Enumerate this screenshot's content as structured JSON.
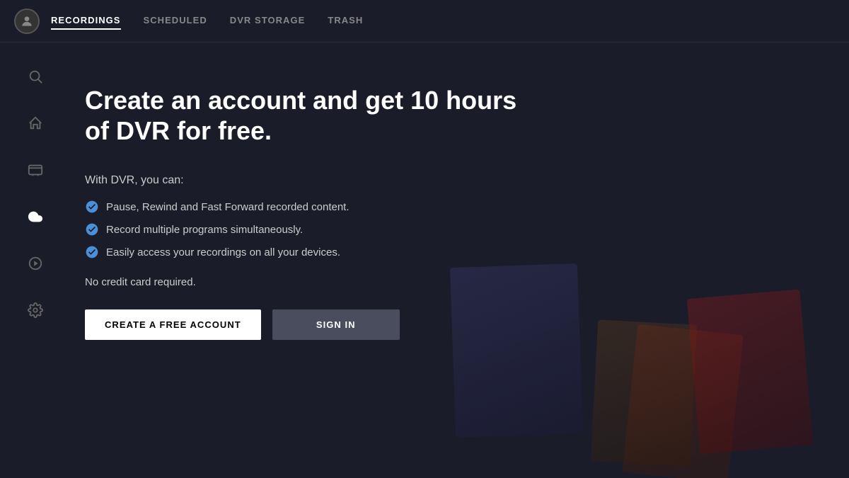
{
  "nav": {
    "tabs": [
      {
        "id": "recordings",
        "label": "RECORDINGS",
        "active": true
      },
      {
        "id": "scheduled",
        "label": "SCHEDULED",
        "active": false
      },
      {
        "id": "dvr-storage",
        "label": "DVR STORAGE",
        "active": false
      },
      {
        "id": "trash",
        "label": "TRASH",
        "active": false
      }
    ]
  },
  "sidebar": {
    "icons": [
      {
        "id": "search",
        "label": "Search",
        "active": false
      },
      {
        "id": "home",
        "label": "Home",
        "active": false
      },
      {
        "id": "guide",
        "label": "Guide",
        "active": false
      },
      {
        "id": "recordings",
        "label": "Recordings / Cloud DVR",
        "active": true
      },
      {
        "id": "on-demand",
        "label": "On Demand",
        "active": false
      },
      {
        "id": "settings",
        "label": "Settings",
        "active": false
      }
    ]
  },
  "main": {
    "title": "Create an account and get 10 hours of DVR for free.",
    "intro": "With DVR, you can:",
    "features": [
      "Pause, Rewind and Fast Forward recorded content.",
      "Record multiple programs simultaneously.",
      "Easily access your recordings on all your devices."
    ],
    "no_cc_text": "No credit card required.",
    "create_button_label": "CREATE A FREE ACCOUNT",
    "signin_button_label": "SIGN IN"
  }
}
